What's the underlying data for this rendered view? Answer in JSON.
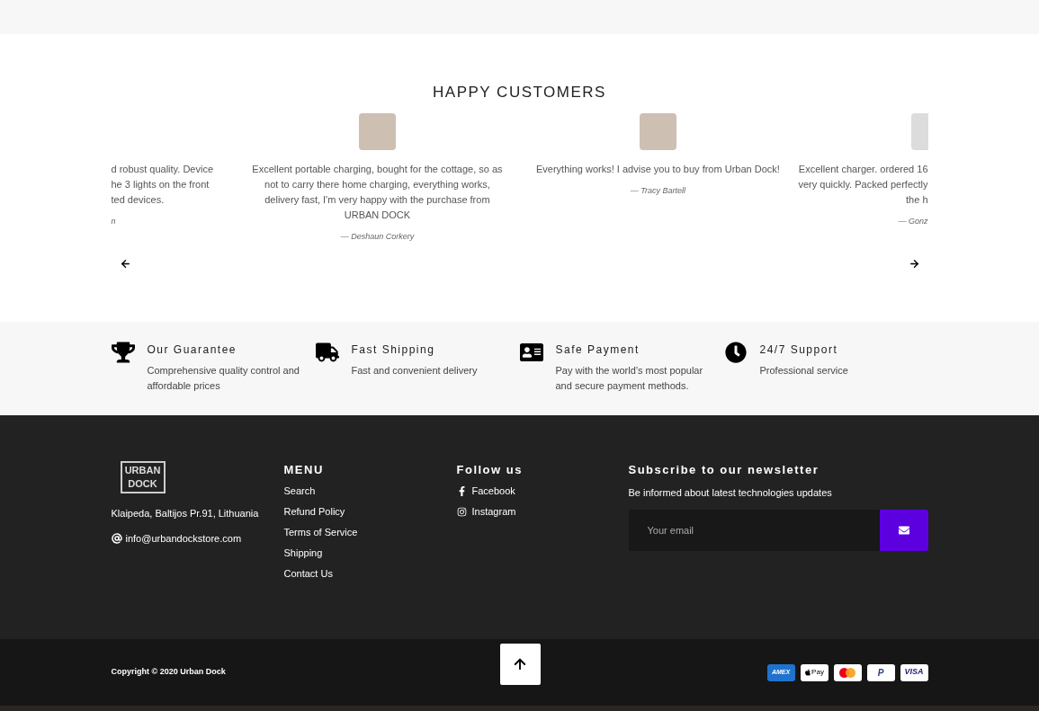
{
  "testimonials": {
    "title": "HAPPY CUSTOMERS",
    "slides": [
      {
        "kind": "clipped-left",
        "lines": [
          "d robust quality. Device",
          "he 3 lights on the front",
          "ted devices."
        ],
        "author": "n"
      },
      {
        "kind": "full",
        "text": "Excellent portable charging, bought for the cottage, so as not to carry there home charging, everything works, delivery fast, I'm very happy with the purchase from URBAN DOCK",
        "author": "— Deshaun Corkery"
      },
      {
        "kind": "full",
        "text": "Everything works! I advise you to buy from Urban Dock!",
        "author": "— Tracy Bartell"
      },
      {
        "kind": "clipped-right",
        "lines": [
          "Excellent charger. ordered 16",
          "very quickly. Packed perfectly",
          "the h"
        ],
        "author": "— Gonz"
      }
    ]
  },
  "features": [
    {
      "kind": "trophy",
      "title": "Our Guarantee",
      "text": "Comprehensive quality control and affordable prices"
    },
    {
      "kind": "truck",
      "title": "Fast Shipping",
      "text": "Fast and convenient delivery"
    },
    {
      "kind": "card",
      "title": "Safe Payment",
      "text": "Pay with the world’s most popular and secure payment methods."
    },
    {
      "kind": "clock",
      "title": "24/7 Support",
      "text": "Professional service"
    }
  ],
  "footer": {
    "logo": [
      "URBAN",
      "DOCK"
    ],
    "address": "Klaipeda, Baltijos Pr.91, Lithuania",
    "email": "info@urbandockstore.com",
    "menu": {
      "title": "MENU",
      "items": [
        "Search",
        "Refund Policy",
        "Terms of Service",
        "Shipping",
        "Contact Us"
      ]
    },
    "social": {
      "title": "Follow us",
      "items": [
        {
          "kind": "facebook",
          "label": "Facebook"
        },
        {
          "kind": "instagram",
          "label": "Instagram"
        }
      ]
    },
    "newsletter": {
      "title": "Subscribe to our newsletter",
      "text": "Be informed about latest technologies updates",
      "placeholder": "Your email"
    }
  },
  "bottom": {
    "copyright": "Copyright © 2020 Urban Dock",
    "payments": [
      {
        "kind": "amex",
        "label": "AMEX"
      },
      {
        "kind": "applepay",
        "label": "Pay"
      },
      {
        "kind": "mastercard"
      },
      {
        "kind": "paypal",
        "label": "P"
      },
      {
        "kind": "visa",
        "label": "VISA"
      }
    ]
  }
}
